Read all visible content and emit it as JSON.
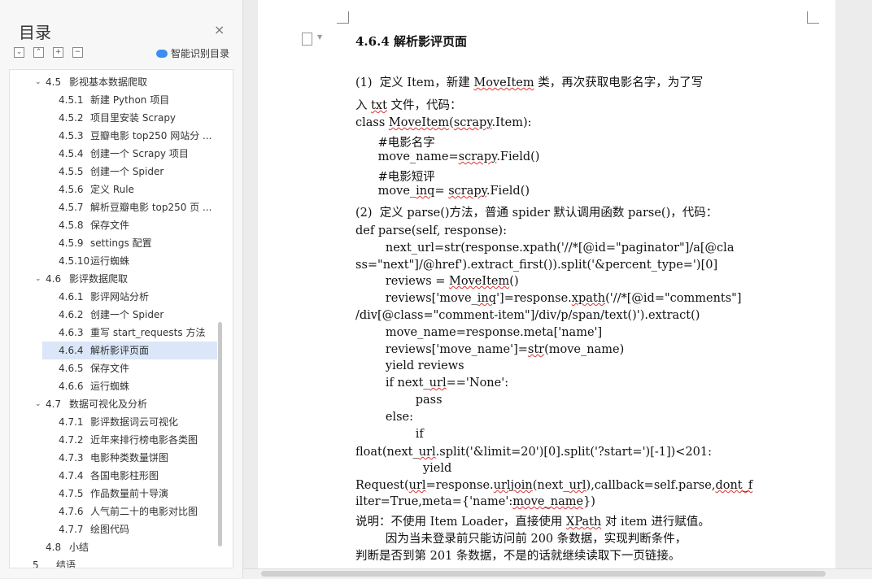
{
  "sidebar": {
    "title": "目录",
    "close_icon": "×",
    "smart_toc_label": "智能识别目录",
    "toolbar_icons": [
      "expand-icon",
      "collapse-icon",
      "add-icon",
      "remove-icon"
    ],
    "items": [
      {
        "num": "4.5",
        "label": "影视基本数据爬取",
        "level": 1,
        "expanded": true
      },
      {
        "num": "4.5.1",
        "label": "新建 Python 项目",
        "level": 2
      },
      {
        "num": "4.5.2",
        "label": "项目里安装 Scrapy",
        "level": 2
      },
      {
        "num": "4.5.3",
        "label": "豆瓣电影 top250 网站分 ...",
        "level": 2
      },
      {
        "num": "4.5.4",
        "label": "创建一个 Scrapy 项目",
        "level": 2
      },
      {
        "num": "4.5.5",
        "label": "创建一个 Spider",
        "level": 2
      },
      {
        "num": "4.5.6",
        "label": "定义 Rule",
        "level": 2
      },
      {
        "num": "4.5.7",
        "label": "解析豆瓣电影 top250 页 ...",
        "level": 2
      },
      {
        "num": "4.5.8",
        "label": "保存文件",
        "level": 2
      },
      {
        "num": "4.5.9",
        "label": "settings 配置",
        "level": 2
      },
      {
        "num": "4.5.10",
        "label": "运行蜘蛛",
        "level": 2
      },
      {
        "num": "4.6",
        "label": "影评数据爬取",
        "level": 1,
        "expanded": true
      },
      {
        "num": "4.6.1",
        "label": "影评网站分析",
        "level": 2
      },
      {
        "num": "4.6.2",
        "label": "创建一个 Spider",
        "level": 2
      },
      {
        "num": "4.6.3",
        "label": "重写 start_requests 方法",
        "level": 2
      },
      {
        "num": "4.6.4",
        "label": "解析影评页面",
        "level": 2,
        "selected": true
      },
      {
        "num": "4.6.5",
        "label": "保存文件",
        "level": 2
      },
      {
        "num": "4.6.6",
        "label": "运行蜘蛛",
        "level": 2
      },
      {
        "num": "4.7",
        "label": "数据可视化及分析",
        "level": 1,
        "expanded": true
      },
      {
        "num": "4.7.1",
        "label": "影评数据词云可视化",
        "level": 2
      },
      {
        "num": "4.7.2",
        "label": "近年来排行榜电影各类图",
        "level": 2
      },
      {
        "num": "4.7.3",
        "label": "电影种类数量饼图",
        "level": 2
      },
      {
        "num": "4.7.4",
        "label": "各国电影柱形图",
        "level": 2
      },
      {
        "num": "4.7.5",
        "label": "作品数量前十导演",
        "level": 2
      },
      {
        "num": "4.7.6",
        "label": "人气前二十的电影对比图",
        "level": 2
      },
      {
        "num": "4.7.7",
        "label": "绘图代码",
        "level": 2
      },
      {
        "num": "4.8",
        "label": "小结",
        "level": 1
      },
      {
        "num": "5",
        "label": "结语",
        "level": 0
      }
    ]
  },
  "document": {
    "heading": "4.6.4  解析影评页面",
    "lines": [
      {
        "html": "(1)  定义 Item，新建 <u>MoveItem</u> 类，再次获取电影名字，为了写"
      },
      {
        "html": "入 <u>txt</u> 文件，代码："
      },
      {
        "html": "class <u>MoveItem</u>(<u>scrapy</u>.Item):"
      },
      {
        "html": "      #电影名字"
      },
      {
        "html": "      move_name=<u>scrapy</u>.Field()"
      },
      {
        "html": "      #电影短评"
      },
      {
        "html": "      move_<u>inq</u>= <u>scrapy</u>.Field()"
      },
      {
        "html": "(2)  定义 parse()方法，普通 spider 默认调用函数 parse()，代码："
      },
      {
        "html": "def parse(self, response):"
      },
      {
        "html": "        next_url=str(response.xpath('//*[@id=\"paginator\"]/a[@cla"
      },
      {
        "html": "ss=\"next\"]/@href').extract_first()).split('&amp;percent_type=')[0]"
      },
      {
        "html": "        reviews = <u>MoveItem</u>()"
      },
      {
        "html": "        reviews['move_<u>inq</u>']=response.<u>xpath</u>('//*[@id=\"comments\"]"
      },
      {
        "html": "/div[@class=\"comment-item\"]/div/p/span/text()').extract()"
      },
      {
        "html": "        move_name=response.meta['name']"
      },
      {
        "html": "        reviews['move_name']=<u>str</u>(move_name)"
      },
      {
        "html": "        yield reviews"
      },
      {
        "html": "        if next_<u>url</u>=='None':"
      },
      {
        "html": "                pass"
      },
      {
        "html": "        else:"
      },
      {
        "html": "                if"
      },
      {
        "html": "float(next_<u>url</u>.split('&amp;limit=20')[0].split('?start=')[-1])&lt;201:"
      },
      {
        "html": "                  yield"
      },
      {
        "html": "Request(<u>url</u>=response.<u>urljoin</u>(next_<u>url</u>),callback=self.parse,<u>dont_f</u>"
      },
      {
        "html": "ilter=True,meta={'name':<u>move_name</u>})"
      },
      {
        "html": "说明：不使用 Item Loader，直接使用 <u>XPath</u> 对 item 进行赋值。"
      },
      {
        "html": "        因为当未登录前只能访问前 200 条数据，实现判断条件，"
      },
      {
        "html": "判断是否到第 201 条数据，不是的话就继续读取下一页链接。"
      }
    ]
  }
}
